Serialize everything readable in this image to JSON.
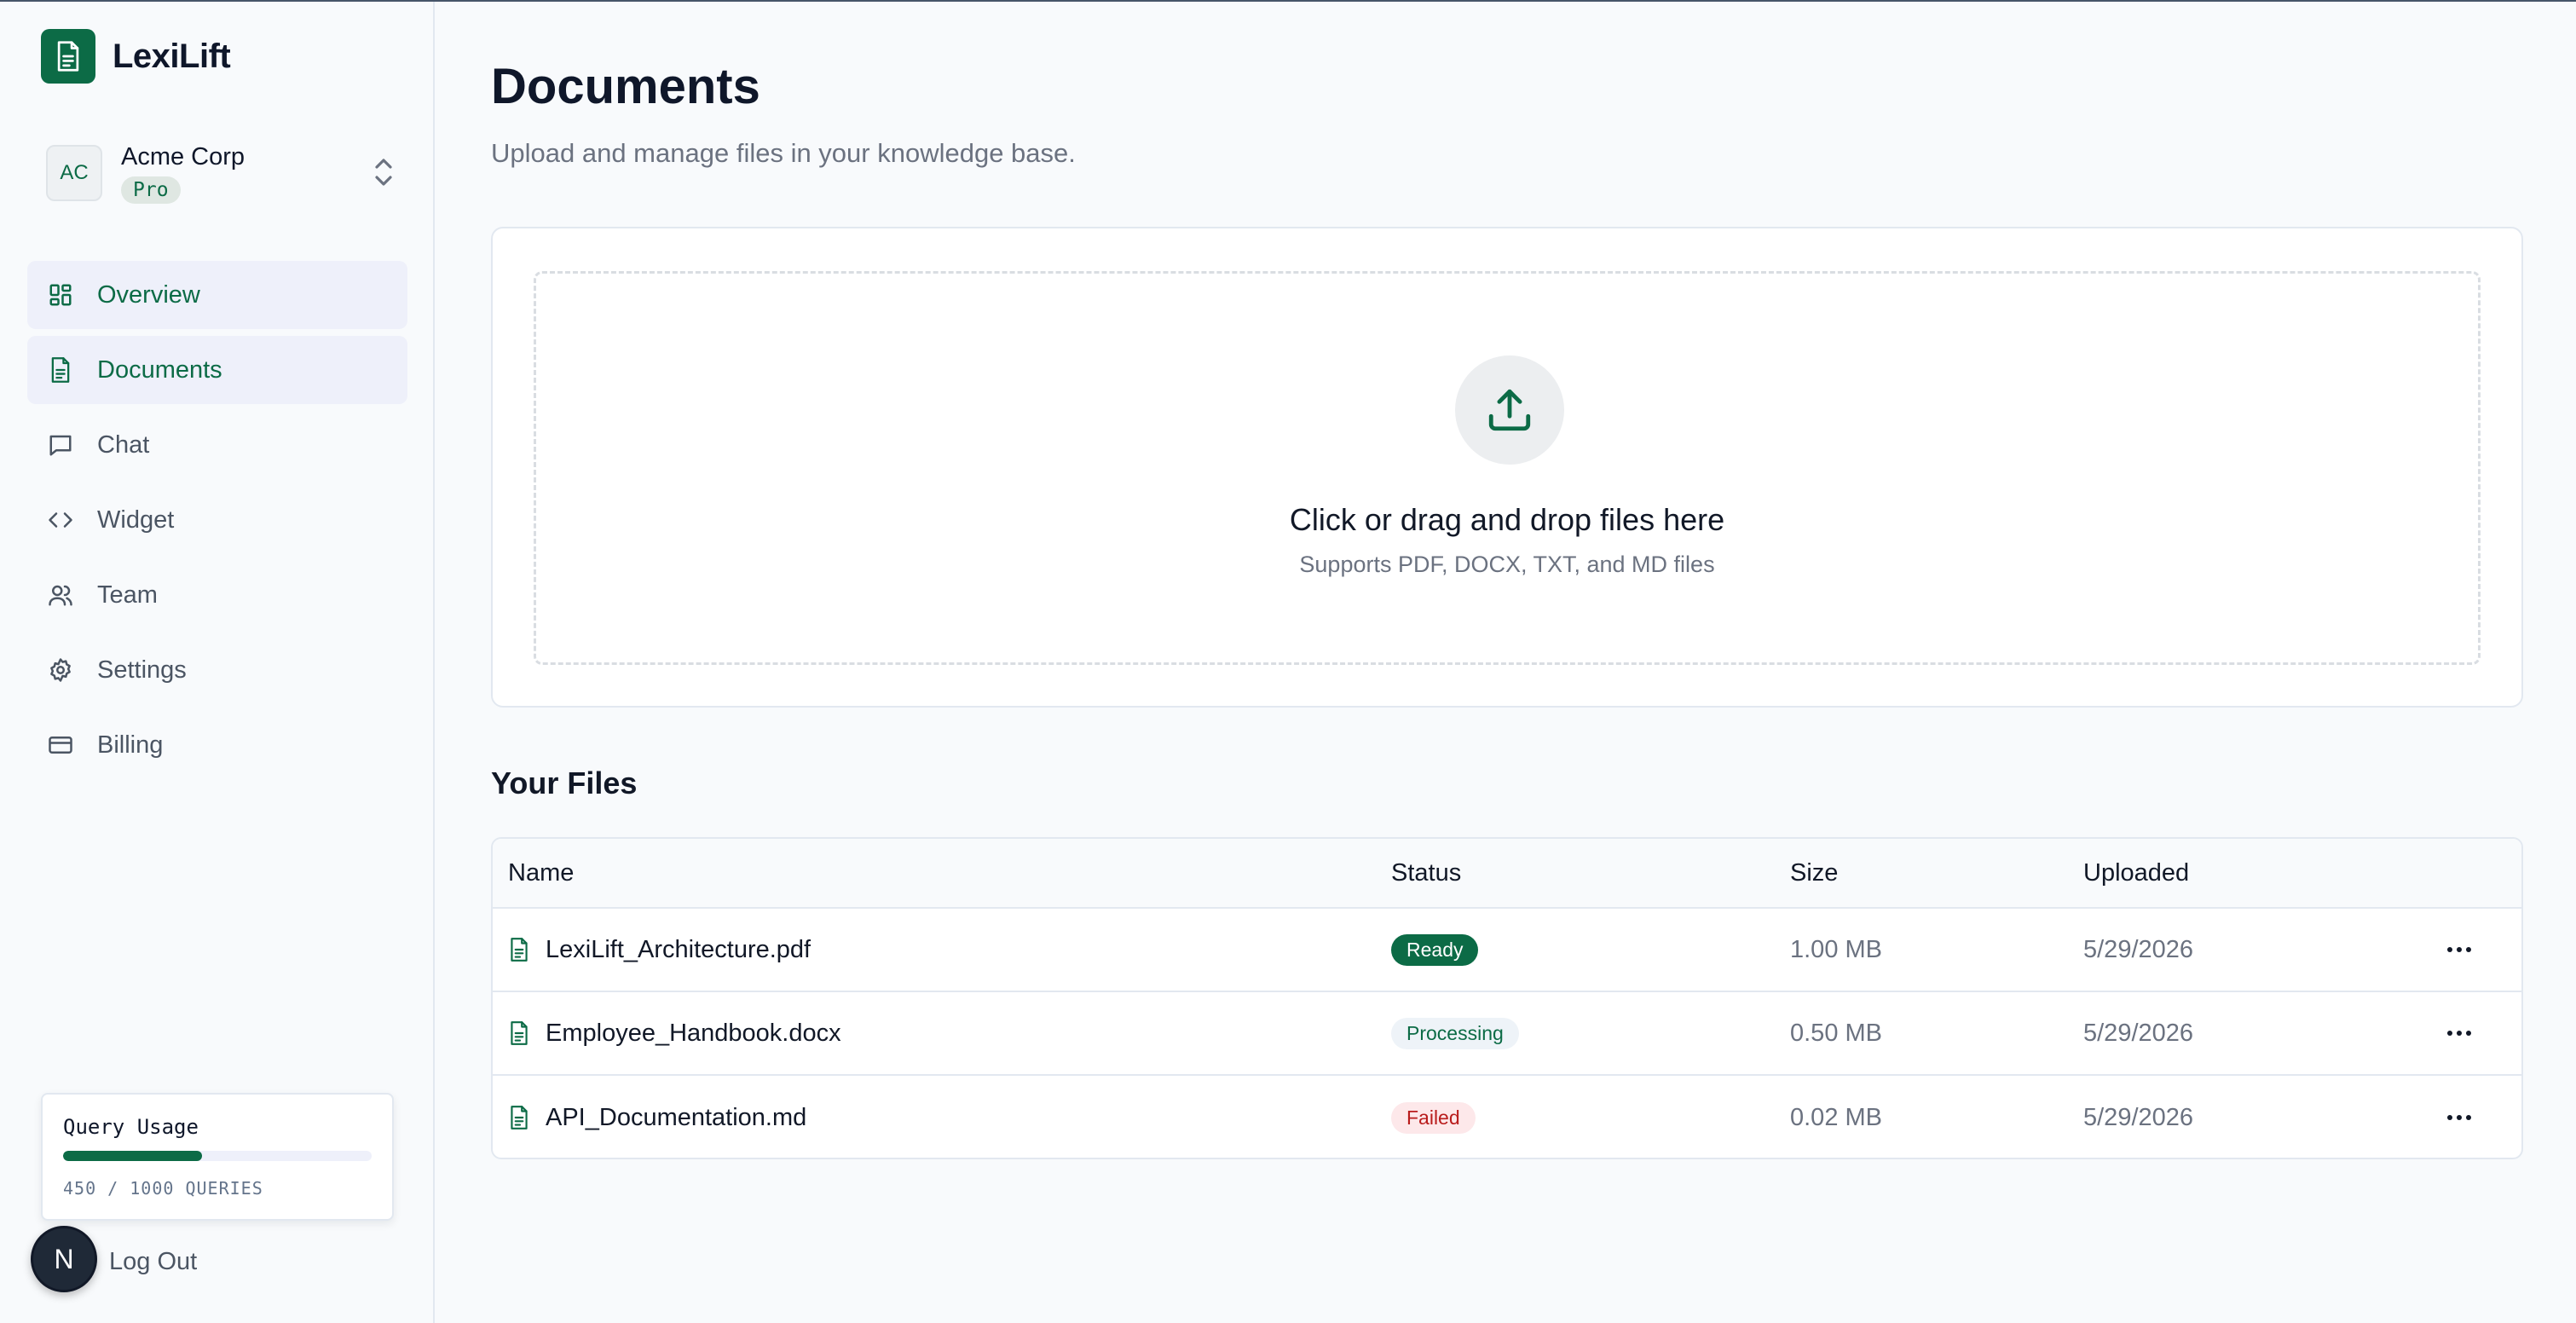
{
  "app": {
    "name": "LexiLift"
  },
  "org": {
    "initials": "AC",
    "name": "Acme Corp",
    "plan": "Pro"
  },
  "nav": [
    {
      "label": "Overview",
      "icon": "dashboard-icon"
    },
    {
      "label": "Documents",
      "icon": "document-icon",
      "active": true
    },
    {
      "label": "Chat",
      "icon": "chat-icon"
    },
    {
      "label": "Widget",
      "icon": "code-icon"
    },
    {
      "label": "Team",
      "icon": "users-icon"
    },
    {
      "label": "Settings",
      "icon": "gear-icon"
    },
    {
      "label": "Billing",
      "icon": "credit-card-icon"
    }
  ],
  "usage": {
    "title": "Query Usage",
    "used": 450,
    "limit": 1000,
    "text": "450 / 1000 QUERIES"
  },
  "user": {
    "initial": "N",
    "logout": "Log Out"
  },
  "page": {
    "title": "Documents",
    "subtitle": "Upload and manage files in your knowledge base."
  },
  "upload": {
    "title": "Click or drag and drop files here",
    "subtitle": "Supports PDF, DOCX, TXT, and MD files"
  },
  "files": {
    "title": "Your Files",
    "columns": [
      "Name",
      "Status",
      "Size",
      "Uploaded"
    ],
    "rows": [
      {
        "name": "LexiLift_Architecture.pdf",
        "status": "Ready",
        "size": "1.00 MB",
        "uploaded": "5/29/2026"
      },
      {
        "name": "Employee_Handbook.docx",
        "status": "Processing",
        "size": "0.50 MB",
        "uploaded": "5/29/2026"
      },
      {
        "name": "API_Documentation.md",
        "status": "Failed",
        "size": "0.02 MB",
        "uploaded": "5/29/2026"
      }
    ]
  },
  "colors": {
    "brand": "#0c6b46",
    "active_bg": "#eef0fa",
    "failed": "#b91c1c"
  }
}
